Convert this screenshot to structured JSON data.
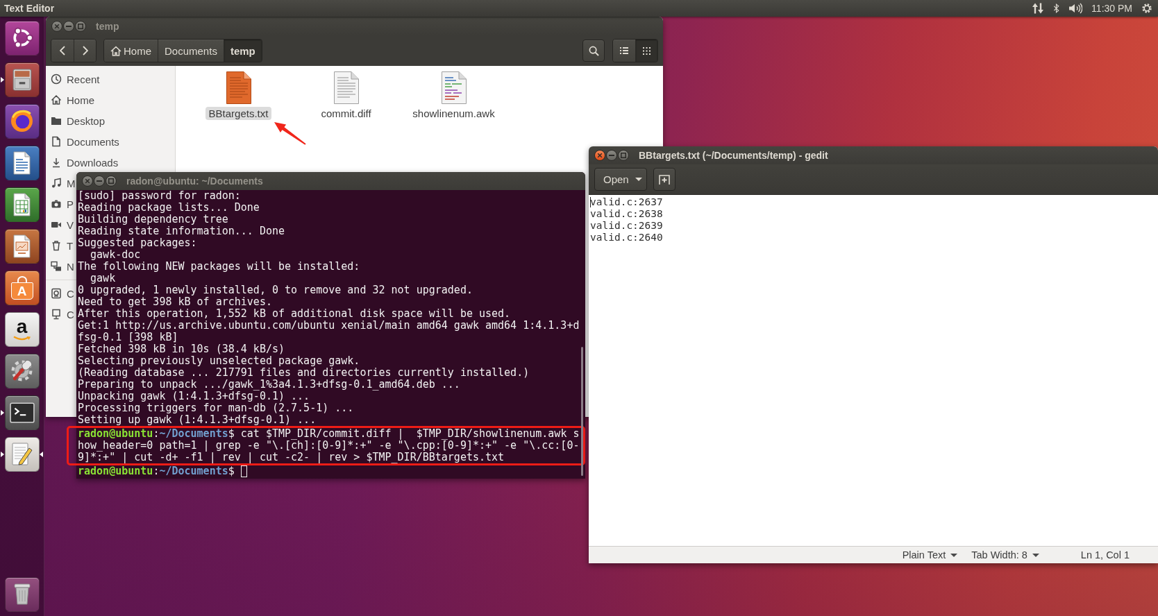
{
  "top_panel": {
    "app_title": "Text Editor",
    "clock": "11:30 PM"
  },
  "launcher": {
    "items": [
      {
        "kind": "dash",
        "running": false,
        "focused": false
      },
      {
        "kind": "files",
        "running": true,
        "focused": false
      },
      {
        "kind": "browser",
        "running": false,
        "focused": false
      },
      {
        "kind": "writer",
        "running": false,
        "focused": false
      },
      {
        "kind": "calc",
        "running": false,
        "focused": false
      },
      {
        "kind": "impress",
        "running": false,
        "focused": false
      },
      {
        "kind": "software",
        "letter": "A",
        "running": false,
        "focused": false
      },
      {
        "kind": "web",
        "letter": "a",
        "running": false,
        "focused": false
      },
      {
        "kind": "settings",
        "running": false,
        "focused": false
      },
      {
        "kind": "terminal",
        "running": true,
        "focused": false
      },
      {
        "kind": "editor",
        "running": true,
        "focused": true
      },
      {
        "kind": "trash",
        "running": false,
        "focused": false
      }
    ]
  },
  "file_manager": {
    "window": {
      "title": "temp",
      "focused": false
    },
    "path": [
      {
        "label": "Home",
        "kind": "home",
        "selected": false
      },
      {
        "label": "Documents",
        "kind": "folder",
        "selected": false
      },
      {
        "label": "temp",
        "kind": "folder",
        "selected": true
      }
    ],
    "view_buttons": [
      {
        "kind": "list",
        "selected": false
      },
      {
        "kind": "grid",
        "selected": true
      }
    ],
    "sidebar": {
      "sections": [
        {
          "items": [
            {
              "label": "Recent",
              "kind": "recent",
              "selected": false
            },
            {
              "label": "Home",
              "kind": "home",
              "selected": false
            },
            {
              "label": "Desktop",
              "kind": "desktop",
              "selected": false
            },
            {
              "label": "Documents",
              "kind": "documents",
              "selected": false
            },
            {
              "label": "Downloads",
              "kind": "downloads",
              "selected": false
            },
            {
              "label": "M",
              "kind": "music",
              "selected": false
            },
            {
              "label": "P",
              "kind": "pictures",
              "selected": false
            },
            {
              "label": "V",
              "kind": "videos",
              "selected": false
            },
            {
              "label": "T",
              "kind": "trash",
              "selected": false
            },
            {
              "label": "N",
              "kind": "network",
              "selected": false
            }
          ]
        },
        {
          "items": [
            {
              "label": "C",
              "kind": "disk",
              "selected": false
            },
            {
              "label": "C",
              "kind": "server",
              "selected": false
            }
          ]
        }
      ]
    },
    "files": [
      {
        "name": "BBtargets.txt",
        "kind": "text",
        "selected": true
      },
      {
        "name": "commit.diff",
        "kind": "diff",
        "selected": false
      },
      {
        "name": "showlinenum.awk",
        "kind": "script",
        "selected": false
      }
    ]
  },
  "terminal": {
    "window": {
      "title": "radon@ubuntu: ~/Documents",
      "focused": false
    },
    "cursor": true,
    "lines": [
      {
        "kind": "output",
        "text": "[sudo] password for radon:",
        "highlighted": false
      },
      {
        "kind": "output",
        "text": "Reading package lists... Done",
        "highlighted": false
      },
      {
        "kind": "output",
        "text": "Building dependency tree",
        "highlighted": false
      },
      {
        "kind": "output",
        "text": "Reading state information... Done",
        "highlighted": false
      },
      {
        "kind": "output",
        "text": "Suggested packages:",
        "highlighted": false
      },
      {
        "kind": "output",
        "text": "  gawk-doc",
        "highlighted": false
      },
      {
        "kind": "output",
        "text": "The following NEW packages will be installed:",
        "highlighted": false
      },
      {
        "kind": "output",
        "text": "  gawk",
        "highlighted": false
      },
      {
        "kind": "output",
        "text": "0 upgraded, 1 newly installed, 0 to remove and 32 not upgraded.",
        "highlighted": false
      },
      {
        "kind": "output",
        "text": "Need to get 398 kB of archives.",
        "highlighted": false
      },
      {
        "kind": "output",
        "text": "After this operation, 1,552 kB of additional disk space will be used.",
        "highlighted": false
      },
      {
        "kind": "output",
        "text": "Get:1 http://us.archive.ubuntu.com/ubuntu xenial/main amd64 gawk amd64 1:4.1.3+d",
        "highlighted": false
      },
      {
        "kind": "output",
        "text": "fsg-0.1 [398 kB]",
        "highlighted": false
      },
      {
        "kind": "output",
        "text": "Fetched 398 kB in 10s (38.4 kB/s)",
        "highlighted": false
      },
      {
        "kind": "output",
        "text": "Selecting previously unselected package gawk.",
        "highlighted": false
      },
      {
        "kind": "output",
        "text": "(Reading database ... 217791 files and directories currently installed.)",
        "highlighted": false
      },
      {
        "kind": "output",
        "text": "Preparing to unpack .../gawk_1%3a4.1.3+dfsg-0.1_amd64.deb ...",
        "highlighted": false
      },
      {
        "kind": "output",
        "text": "Unpacking gawk (1:4.1.3+dfsg-0.1) ...",
        "highlighted": false
      },
      {
        "kind": "output",
        "text": "Processing triggers for man-db (2.7.5-1) ...",
        "highlighted": false
      },
      {
        "kind": "output",
        "text": "Setting up gawk (1:4.1.3+dfsg-0.1) ...",
        "highlighted": false
      },
      {
        "kind": "prompt",
        "user": "radon@ubuntu",
        "colon": ":",
        "path": "~/Documents",
        "symbol": "$",
        "command": "cat $TMP_DIR/commit.diff |  $TMP_DIR/showlinenum.awk s",
        "highlighted": true
      },
      {
        "kind": "output",
        "text": "how_header=0 path=1 | grep -e \"\\.[ch]:[0-9]*:+\" -e \"\\.cpp:[0-9]*:+\" -e \"\\.cc:[0-",
        "highlighted": true
      },
      {
        "kind": "output",
        "text": "9]*:+\" | cut -d+ -f1 | rev | cut -c2- | rev > $TMP_DIR/BBtargets.txt",
        "highlighted": true
      },
      {
        "kind": "prompt",
        "user": "radon@ubuntu",
        "colon": ":",
        "path": "~/Documents",
        "symbol": "$",
        "highlighted": false
      }
    ]
  },
  "gedit": {
    "window": {
      "title": "BBtargets.txt (~/Documents/temp) - gedit",
      "focused": true
    },
    "toolbar": {
      "open_label": "Open"
    },
    "cursor": true,
    "lines": [
      "valid.c:2637",
      "valid.c:2638",
      "valid.c:2639",
      "valid.c:2640"
    ],
    "status_bar": [
      {
        "label": "Plain Text",
        "kind": "dropdown"
      },
      {
        "label": "Tab Width: 8",
        "kind": "dropdown"
      },
      {
        "label": "Ln 1, Col 1",
        "kind": "text"
      }
    ]
  }
}
